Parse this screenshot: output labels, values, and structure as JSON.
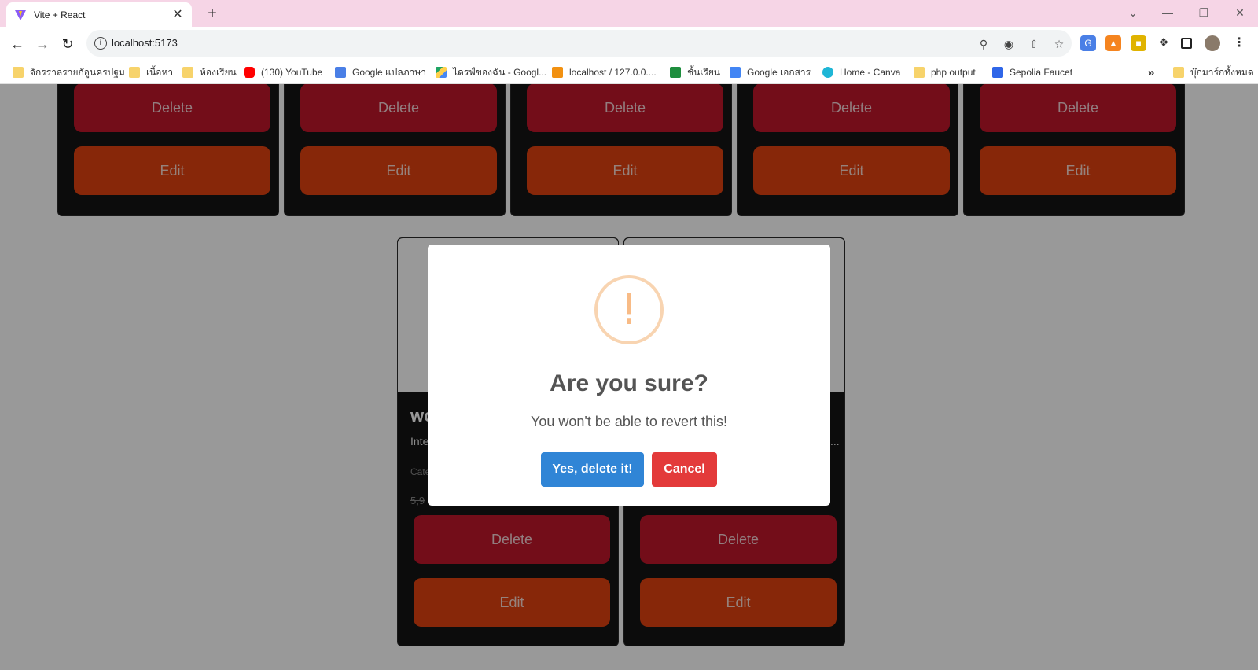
{
  "browser": {
    "tab_title": "Vite + React",
    "tab_close": "✕",
    "new_tab": "+",
    "url": "localhost:5173",
    "win_minimize": "—",
    "win_restore": "❐",
    "win_close": "✕",
    "win_dropdown": "⌄"
  },
  "bookmarks": [
    {
      "label": "จักรราลรายกัอูนครปฐม",
      "icon": "folder-icon"
    },
    {
      "label": "เนื้อหา",
      "icon": "folder-icon"
    },
    {
      "label": "ห้องเรียน",
      "icon": "folder-icon"
    },
    {
      "label": "(130) YouTube",
      "icon": "youtube-icon"
    },
    {
      "label": "Google แปลภาษา",
      "icon": "google-translate-icon"
    },
    {
      "label": "ไดรฟ์ของฉัน - Googl...",
      "icon": "google-drive-icon"
    },
    {
      "label": "localhost / 127.0.0....",
      "icon": "phpmyadmin-icon"
    },
    {
      "label": "ชั้นเรียน",
      "icon": "classroom-icon"
    },
    {
      "label": "Google เอกสาร",
      "icon": "google-docs-icon"
    },
    {
      "label": "Home - Canva",
      "icon": "canva-icon"
    },
    {
      "label": "php output",
      "icon": "folder-icon"
    },
    {
      "label": "Sepolia Faucet",
      "icon": "alchemy-icon"
    }
  ],
  "bookmarks_more": "»",
  "bookmarks_all": "บุ๊กมาร์กทั้งหมด",
  "cards": {
    "delete_label": "Delete",
    "edit_label": "Edit",
    "partial_title": "wo",
    "partial_desc": "Inte",
    "partial_category": "Cate",
    "partial_price": "5,9",
    "partial_desc_right": "..."
  },
  "modal": {
    "title": "Are you sure?",
    "text": "You won't be able to revert this!",
    "icon": "!",
    "confirm_label": "Yes, delete it!",
    "cancel_label": "Cancel"
  },
  "colors": {
    "delete": "#c0172a",
    "edit": "#e2420f",
    "confirm": "#3085d6",
    "cancel": "#e33a3a",
    "warning": "#f8bb86"
  }
}
